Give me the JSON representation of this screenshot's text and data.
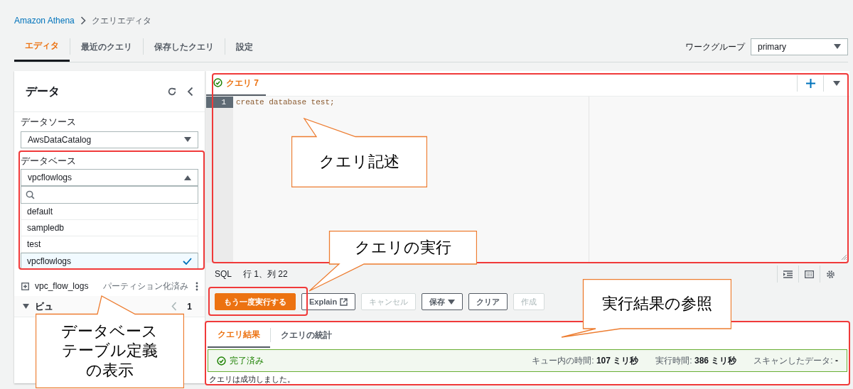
{
  "breadcrumb": {
    "parent": "Amazon Athena",
    "current": "クエリエディタ"
  },
  "tabs": [
    {
      "label": "エディタ",
      "selected": true
    },
    {
      "label": "最近のクエリ",
      "selected": false
    },
    {
      "label": "保存したクエリ",
      "selected": false
    },
    {
      "label": "設定",
      "selected": false
    }
  ],
  "workgroup": {
    "label": "ワークグループ",
    "value": "primary"
  },
  "data_panel": {
    "title": "データ",
    "data_source": {
      "label": "データソース",
      "value": "AwsDataCatalog"
    },
    "database": {
      "label": "データベース",
      "value": "vpcflowlogs",
      "expanded": true,
      "options": [
        {
          "label": "default",
          "selected": false
        },
        {
          "label": "sampledb",
          "selected": false
        },
        {
          "label": "test",
          "selected": false
        },
        {
          "label": "vpcflowlogs",
          "selected": true
        }
      ]
    },
    "tables": [
      {
        "name": "vpc_flow_logs",
        "note": "パーティション化済み"
      }
    ],
    "views": {
      "label": "ビュ",
      "expanded": true,
      "page": "1"
    }
  },
  "editor": {
    "tabs": [
      {
        "label": "クエリ 7",
        "selected": true,
        "succeeded": true
      }
    ],
    "lines": [
      {
        "number": "1",
        "code": "create database test;",
        "active": true
      }
    ],
    "language": "SQL",
    "position": "行 1、列 22"
  },
  "actions": [
    {
      "label": "もう一度実行する",
      "kind": "primary",
      "disabled": false
    },
    {
      "label": "Explain",
      "kind": "external",
      "disabled": false
    },
    {
      "label": "キャンセル",
      "kind": "normal",
      "disabled": true
    },
    {
      "label": "保存",
      "kind": "dropdown",
      "disabled": false
    },
    {
      "label": "クリア",
      "kind": "normal",
      "disabled": false
    },
    {
      "label": "作成",
      "kind": "normal",
      "disabled": true
    }
  ],
  "results": {
    "tabs": [
      {
        "label": "クエリ結果",
        "selected": true
      },
      {
        "label": "クエリの統計",
        "selected": false
      }
    ],
    "status": "完了済み",
    "metrics": [
      {
        "label": "キュー内の時間:",
        "value": "107 ミリ秒"
      },
      {
        "label": "実行時間:",
        "value": "386 ミリ秒"
      },
      {
        "label": "スキャンしたデータ:",
        "value": "-"
      }
    ],
    "message": "クエリは成功しました。"
  },
  "annotations": [
    {
      "kind": "frame"
    },
    {
      "kind": "frame"
    },
    {
      "kind": "frame"
    },
    {
      "kind": "frame"
    },
    {
      "kind": "callout",
      "text": "クエリ記述"
    },
    {
      "kind": "callout",
      "text": "クエリの実行"
    },
    {
      "kind": "callout",
      "text": "実行結果の参照"
    },
    {
      "kind": "callout",
      "text": "データベーステーブル定義の表示"
    }
  ]
}
